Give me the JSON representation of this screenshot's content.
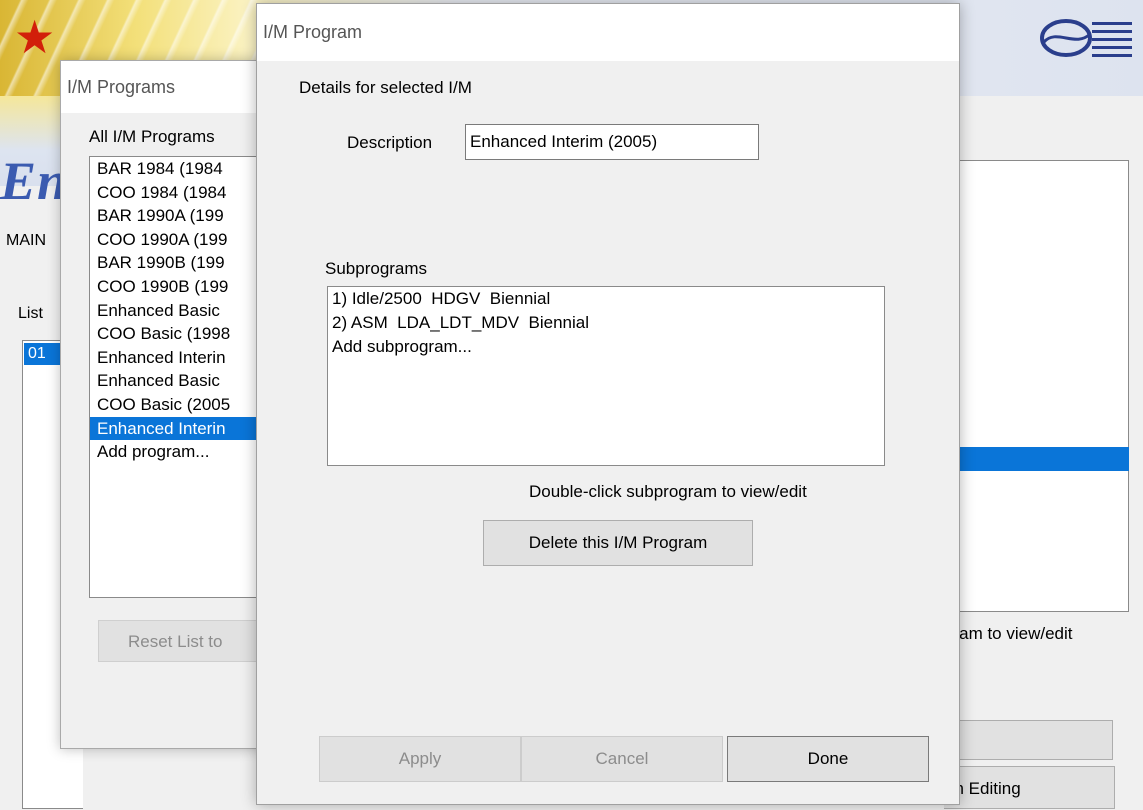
{
  "background_app": {
    "menu_label": "MAIN",
    "list_label": "List",
    "list_selected_item": "01",
    "right_hint": "gram to view/edit",
    "finish_editing_label": "sh Editing",
    "brand_partial": "En"
  },
  "programs_window": {
    "title": "I/M Programs",
    "list_label": "All I/M Programs",
    "items": [
      "BAR 1984 (1984",
      "COO 1984 (1984",
      "BAR 1990A (199",
      "COO 1990A (199",
      "BAR 1990B (199",
      "COO 1990B (199",
      "Enhanced Basic",
      "COO Basic (1998",
      "Enhanced Interin",
      "Enhanced Basic",
      "COO Basic (2005",
      "Enhanced Interin",
      "Add program..."
    ],
    "selected_index": 11,
    "reset_button": "Reset List to"
  },
  "program_dialog": {
    "title": "I/M Program",
    "details_label": "Details for selected I/M",
    "description_label": "Description",
    "description_value": "Enhanced Interim (2005)",
    "subprograms_label": "Subprograms",
    "subprograms": [
      "1) Idle/2500  HDGV  Biennial",
      "2) ASM  LDA_LDT_MDV  Biennial",
      "Add subprogram..."
    ],
    "hint": "Double-click subprogram to view/edit",
    "delete_button": "Delete this I/M Program",
    "apply_button": "Apply",
    "cancel_button": "Cancel",
    "done_button": "Done"
  },
  "colors": {
    "selection": "#0a75d8",
    "star": "#d21f0a"
  }
}
